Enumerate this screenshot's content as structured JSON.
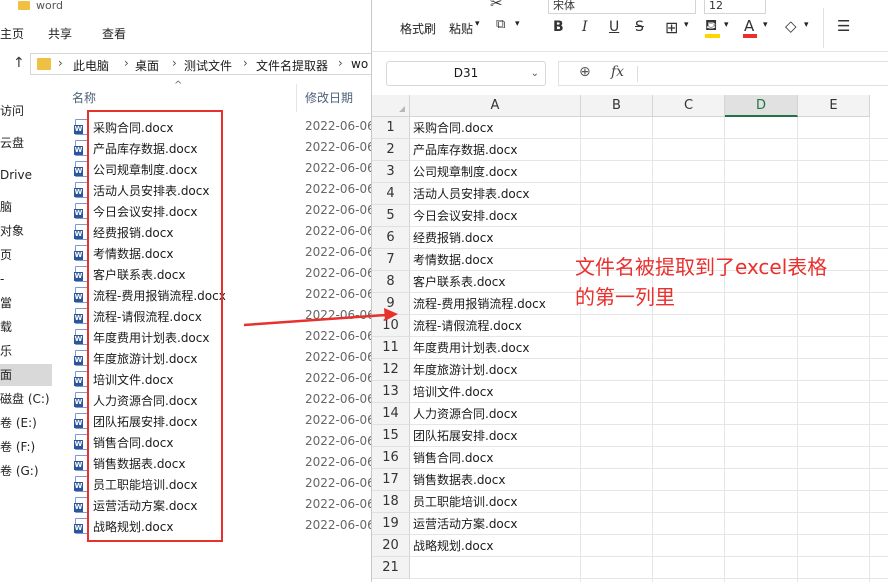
{
  "explorer": {
    "title": "word",
    "ribbon_tabs": [
      "主页",
      "共享",
      "查看"
    ],
    "breadcrumb": [
      "此电脑",
      "桌面",
      "测试文件",
      "文件名提取器",
      "wo"
    ],
    "nav_items": [
      "访问",
      "云盘",
      "Drive",
      "脑",
      "对象",
      "页",
      "-",
      "當",
      "载",
      "乐",
      "面",
      "磁盘 (C:)",
      "卷 (E:)",
      "卷 (F:)",
      "卷 (G:)"
    ],
    "columns": {
      "name": "名称",
      "date": "修改日期"
    },
    "files": [
      {
        "name": "采购合同.docx",
        "date": "2022-06-06"
      },
      {
        "name": "产品库存数据.docx",
        "date": "2022-06-06"
      },
      {
        "name": "公司规章制度.docx",
        "date": "2022-06-06"
      },
      {
        "name": "活动人员安排表.docx",
        "date": "2022-06-06"
      },
      {
        "name": "今日会议安排.docx",
        "date": "2022-06-06"
      },
      {
        "name": "经费报销.docx",
        "date": "2022-06-06"
      },
      {
        "name": "考情数据.docx",
        "date": "2022-06-06"
      },
      {
        "name": "客户联系表.docx",
        "date": "2022-06-06"
      },
      {
        "name": "流程-费用报销流程.docx",
        "date": "2022-06-06"
      },
      {
        "name": "流程-请假流程.docx",
        "date": "2022-06-06"
      },
      {
        "name": "年度费用计划表.docx",
        "date": "2022-06-06"
      },
      {
        "name": "年度旅游计划.docx",
        "date": "2022-06-06"
      },
      {
        "name": "培训文件.docx",
        "date": "2022-06-06"
      },
      {
        "name": "人力资源合同.docx",
        "date": "2022-06-06"
      },
      {
        "name": "团队拓展安排.docx",
        "date": "2022-06-06"
      },
      {
        "name": "销售合同.docx",
        "date": "2022-06-06"
      },
      {
        "name": "销售数据表.docx",
        "date": "2022-06-06"
      },
      {
        "name": "员工职能培训.docx",
        "date": "2022-06-06"
      },
      {
        "name": "运营活动方案.docx",
        "date": "2022-06-06"
      },
      {
        "name": "战略规划.docx",
        "date": "2022-06-06"
      }
    ]
  },
  "spreadsheet": {
    "toolbar": {
      "format_painter": "格式刷",
      "paste": "粘贴",
      "font_name": "宋体",
      "font_size": "12",
      "bold": "B",
      "italic": "I",
      "underline": "U",
      "strike": "S",
      "font_color_letter": "A"
    },
    "name_box": "D31",
    "fx_label": "fx",
    "columns": [
      "A",
      "B",
      "C",
      "D",
      "E"
    ],
    "active_column": "D",
    "rows": [
      {
        "n": "1",
        "a": "采购合同.docx"
      },
      {
        "n": "2",
        "a": "产品库存数据.docx"
      },
      {
        "n": "3",
        "a": "公司规章制度.docx"
      },
      {
        "n": "4",
        "a": "活动人员安排表.docx"
      },
      {
        "n": "5",
        "a": "今日会议安排.docx"
      },
      {
        "n": "6",
        "a": "经费报销.docx"
      },
      {
        "n": "7",
        "a": "考情数据.docx"
      },
      {
        "n": "8",
        "a": "客户联系表.docx"
      },
      {
        "n": "9",
        "a": "流程-费用报销流程.docx"
      },
      {
        "n": "10",
        "a": "流程-请假流程.docx"
      },
      {
        "n": "11",
        "a": "年度费用计划表.docx"
      },
      {
        "n": "12",
        "a": "年度旅游计划.docx"
      },
      {
        "n": "13",
        "a": "培训文件.docx"
      },
      {
        "n": "14",
        "a": "人力资源合同.docx"
      },
      {
        "n": "15",
        "a": "团队拓展安排.docx"
      },
      {
        "n": "16",
        "a": "销售合同.docx"
      },
      {
        "n": "17",
        "a": "销售数据表.docx"
      },
      {
        "n": "18",
        "a": "员工职能培训.docx"
      },
      {
        "n": "19",
        "a": "运营活动方案.docx"
      },
      {
        "n": "20",
        "a": "战略规划.docx"
      },
      {
        "n": "21",
        "a": ""
      }
    ]
  },
  "annotation": {
    "line1": "文件名被提取到了excel表格",
    "line2": "的第一列里",
    "color": "#e8302d"
  },
  "colors": {
    "accent_green": "#217346",
    "highlight_red": "#e8302d"
  }
}
